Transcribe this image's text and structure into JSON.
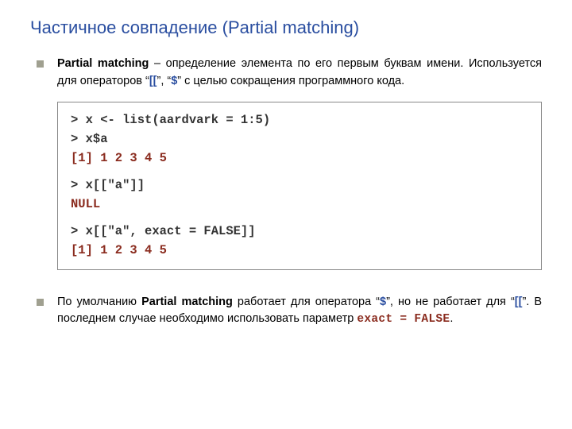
{
  "title": "Частичное совпадение (Partial matching)",
  "para1": {
    "lead": "Partial matching",
    "mid1": " – определение элемента по его первым буквам имени. Используется для операторов “",
    "op1": "[[",
    "mid2": "”, “",
    "op2": "$",
    "tail": "” с целью сокращения программного кода."
  },
  "code": {
    "l1": "> x <- list(aardvark = 1:5)",
    "l2": "> x$a",
    "o1": "[1] 1 2 3 4 5",
    "l3": "> x[[\"a\"]]",
    "o2": "NULL",
    "l4": "> x[[\"a\", exact = FALSE]]",
    "o3": "[1] 1 2 3 4 5"
  },
  "para2": {
    "pre": "По умолчанию ",
    "lead": "Partial matching",
    "mid1": " работает для оператора “",
    "op1": "$",
    "mid2": "”, но не работает для “",
    "op2": "[[",
    "mid3": "”. В последнем случае необходимо использовать параметр   ",
    "mono": "exact = FALSE",
    "tail": "."
  }
}
